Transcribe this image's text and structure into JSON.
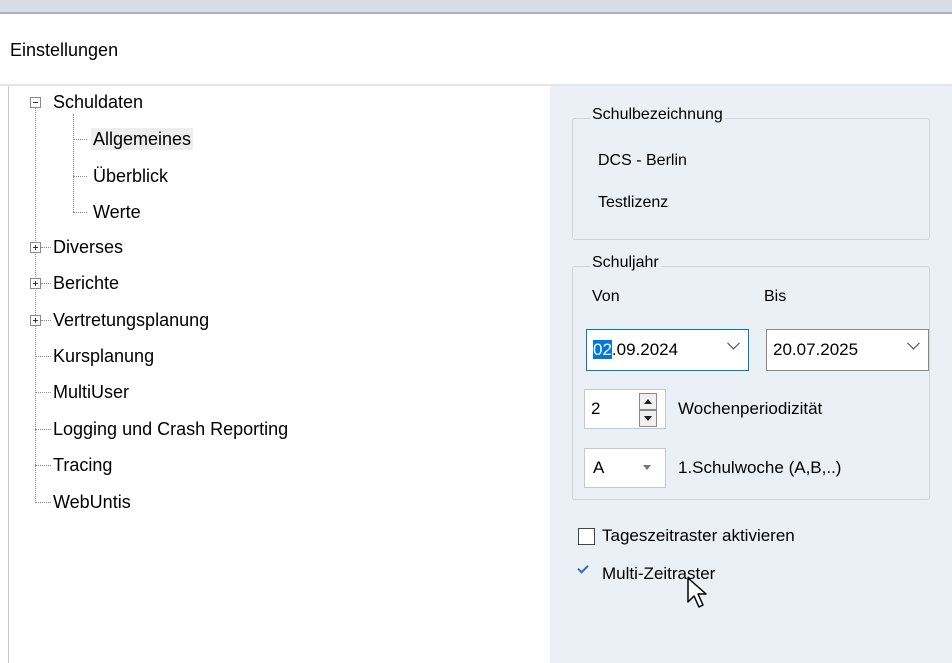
{
  "window": {
    "title": "Einstellungen"
  },
  "tree": {
    "items": [
      {
        "label": "Schuldaten",
        "expanded": true
      },
      {
        "label": "Allgemeines",
        "selected": true
      },
      {
        "label": "Überblick"
      },
      {
        "label": "Werte"
      },
      {
        "label": "Diverses",
        "expandable": true
      },
      {
        "label": "Berichte",
        "expandable": true
      },
      {
        "label": "Vertretungsplanung",
        "expandable": true
      },
      {
        "label": "Kursplanung"
      },
      {
        "label": "MultiUser"
      },
      {
        "label": "Logging und Crash Reporting"
      },
      {
        "label": "Tracing"
      },
      {
        "label": "WebUntis"
      }
    ]
  },
  "school": {
    "legend": "Schulbezeichnung",
    "name": "DCS - Berlin",
    "license": "Testlizenz"
  },
  "schoolyear": {
    "legend": "Schuljahr",
    "from_label": "Von",
    "to_label": "Bis",
    "from_selected": "02",
    "from_rest": ".09.2024",
    "to_value": "20.07.2025",
    "week_period_value": "2",
    "week_period_label": "Wochenperiodizität",
    "first_week_value": "A",
    "first_week_label": "1.Schulwoche (A,B,..)"
  },
  "options": {
    "day_grid_label": "Tageszeitraster aktivieren",
    "day_grid_checked": false,
    "multi_grid_label": "Multi-Zeitraster",
    "multi_grid_checked": true
  },
  "colors": {
    "accent": "#0078d7",
    "panel": "#ebf0f6"
  }
}
